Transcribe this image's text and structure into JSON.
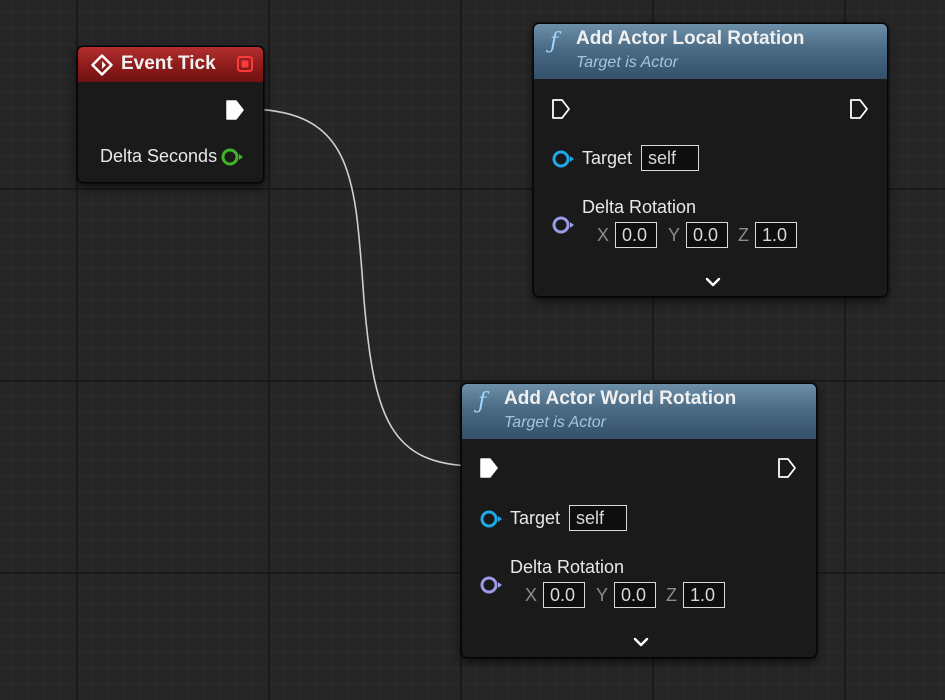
{
  "event_node": {
    "title": "Event Tick",
    "output_pin_label": "Delta Seconds"
  },
  "local_node": {
    "title": "Add Actor Local Rotation",
    "subtitle": "Target is Actor",
    "target_label": "Target",
    "target_value": "self",
    "rotation_label": "Delta Rotation",
    "x_label": "X",
    "y_label": "Y",
    "z_label": "Z",
    "x_value": "0.0",
    "y_value": "0.0",
    "z_value": "1.0"
  },
  "world_node": {
    "title": "Add Actor World Rotation",
    "subtitle": "Target is Actor",
    "target_label": "Target",
    "target_value": "self",
    "rotation_label": "Delta Rotation",
    "x_label": "X",
    "y_label": "Y",
    "z_label": "Z",
    "x_value": "0.0",
    "y_value": "0.0",
    "z_value": "1.0"
  },
  "icons": {
    "event": "event-diamond-icon",
    "function": "function-icon",
    "exec": "exec-pin-icon",
    "float_pin": "float-pin-icon",
    "object_pin": "object-pin-icon",
    "rotator_pin": "rotator-pin-icon",
    "expand": "chevron-down-icon"
  },
  "colors": {
    "event_header": "#8a1a1a",
    "function_header": "#4b6b85",
    "float_pin": "#3fb428",
    "object_pin": "#1fa9e6",
    "rotator_pin": "#9b9be6",
    "wire": "#d0d0d0"
  }
}
